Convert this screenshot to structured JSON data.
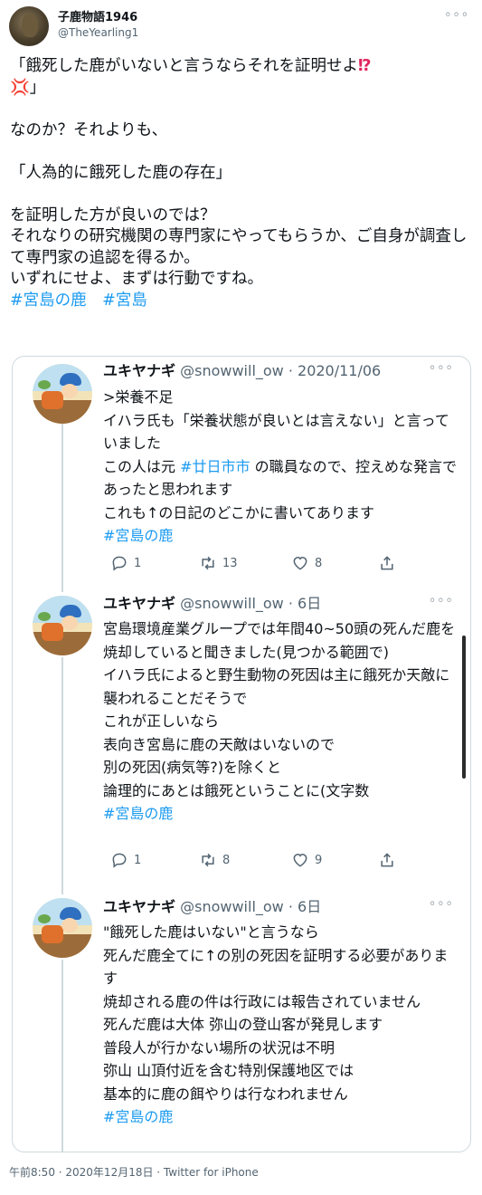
{
  "author": {
    "display_name": "子鹿物語1946",
    "handle": "@TheYearling1",
    "more_label": "◦◦◦"
  },
  "tweet": {
    "line1": "「餓死した鹿がいないと言うならそれを証明せよ",
    "emoji1": "⁉",
    "line2_emoji": "💢",
    "line2_rest": "」",
    "para2": "なのか？それよりも、",
    "para3": "「人為的に餓死した鹿の存在」",
    "para4": "を証明した方が良いのでは？\nそれなりの研究機関の専門家にやってもらうか、ご自身が調査して専門家の追認を得るか。\nいずれにせよ、まずは行動ですね。",
    "hashtag1": "#宮島の鹿",
    "hashtag2": "#宮島"
  },
  "quoted": [
    {
      "name": "ユキヤナギ",
      "meta": "@snowwill_ow · 2020/11/06",
      "text_before": ">栄養不足\nイハラ氏も「栄養状態が良いとは言えない」と言っていました\nこの人は元 ",
      "text_link": "#廿日市市",
      "text_after": " の職員なので、控えめな発言であったと思われます\nこれも↑の日記のどこかに書いてあります",
      "hashtag": "#宮島の鹿",
      "replies": "1",
      "retweets": "13",
      "likes": "8"
    },
    {
      "name": "ユキヤナギ",
      "meta": "@snowwill_ow · 6日",
      "text_before": "宮島環境産業グループでは年間40~50頭の死んだ鹿を焼却していると聞きました(見つかる範囲で)\nイハラ氏によると野生動物の死因は主に餓死か天敵に襲われることだそうで\nこれが正しいなら\n表向き宮島に鹿の天敵はいないので\n別の死因(病気等?)を除くと\n論理的にあとは餓死ということに(文字数",
      "text_link": "",
      "text_after": "",
      "hashtag": "#宮島の鹿",
      "replies": "1",
      "retweets": "8",
      "likes": "9"
    },
    {
      "name": "ユキヤナギ",
      "meta": "@snowwill_ow · 6日",
      "text_before": "\"餓死した鹿はいない\"と言うなら\n死んだ鹿全てに↑の別の死因を証明する必要があります\n焼却される鹿の件は行政には報告されていません\n死んだ鹿は大体 弥山の登山客が発見します\n普段人が行かない場所の状況は不明\n弥山 山頂付近を含む特別保護地区では\n基本的に鹿の餌やりは行なわれません",
      "text_link": "",
      "text_after": "",
      "hashtag": "#宮島の鹿",
      "replies": "",
      "retweets": "",
      "likes": ""
    }
  ],
  "footer": "午前8:50 · 2020年12月18日 · Twitter for iPhone",
  "colors": {
    "link": "#1d9bf0",
    "text": "#0f1419",
    "muted": "#536471",
    "border": "#cfd9de"
  }
}
